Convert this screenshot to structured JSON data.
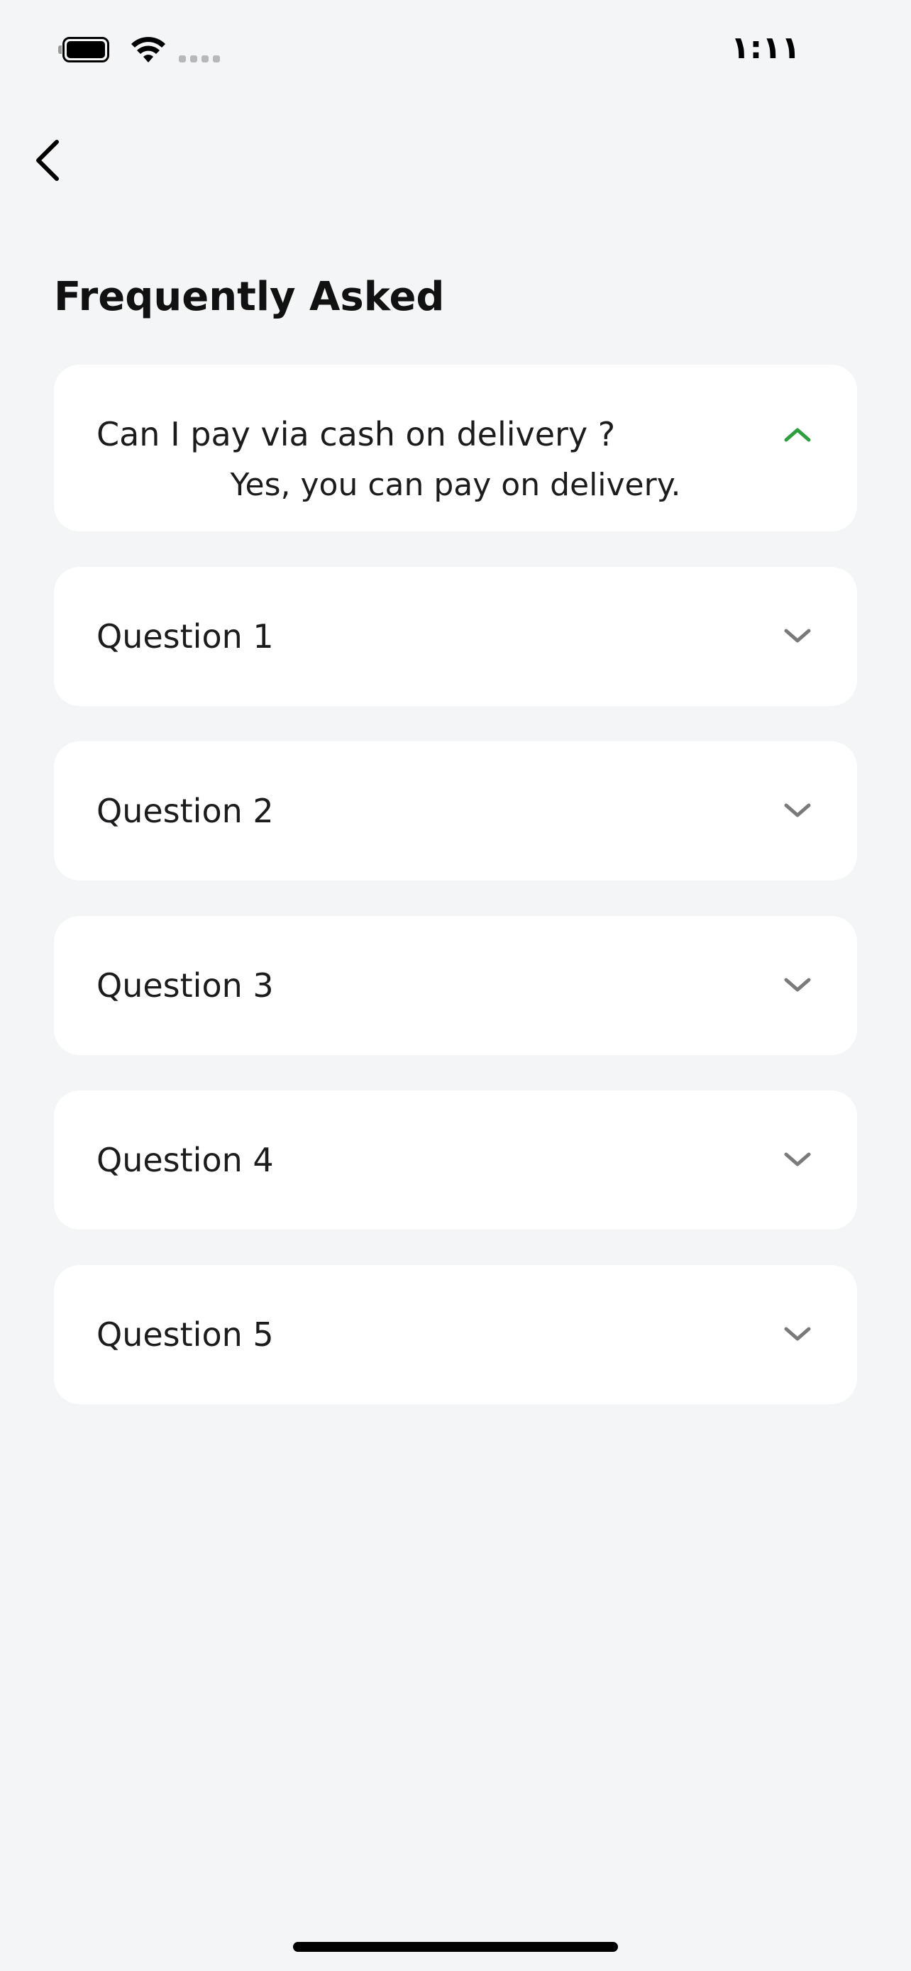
{
  "status_bar": {
    "time": "١:١١",
    "battery_icon": "battery-icon",
    "wifi_icon": "wifi-icon"
  },
  "nav": {
    "back_icon": "chevron-left-icon"
  },
  "page": {
    "title": "Frequently Asked"
  },
  "faq": [
    {
      "question": "Can I pay via cash on delivery ?",
      "answer": "Yes, you can pay on delivery.",
      "expanded": true
    },
    {
      "question": "Question 1",
      "expanded": false
    },
    {
      "question": "Question 2",
      "expanded": false
    },
    {
      "question": "Question 3",
      "expanded": false
    },
    {
      "question": "Question 4",
      "expanded": false
    },
    {
      "question": "Question 5",
      "expanded": false
    }
  ],
  "colors": {
    "background": "#f4f5f7",
    "card": "#ffffff",
    "accent": "#2e9e3e",
    "chevron": "#7a7a7a"
  }
}
